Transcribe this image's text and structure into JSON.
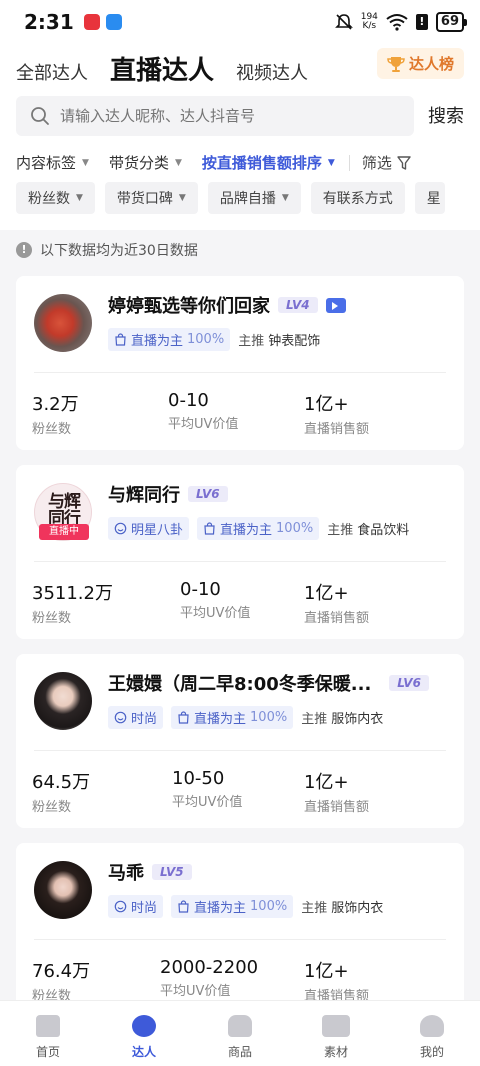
{
  "status_bar": {
    "time": "2:31",
    "net_speed_value": "194",
    "net_speed_unit": "K/s",
    "battery": "69"
  },
  "top_nav": {
    "tabs": [
      "全部达人",
      "直播达人",
      "视频达人"
    ],
    "active_tab": "直播达人",
    "rank_button": "达人榜"
  },
  "search": {
    "placeholder": "请输入达人昵称、达人抖音号",
    "button": "搜索"
  },
  "filters": {
    "items": [
      "内容标签",
      "带货分类",
      "按直播销售额排序"
    ],
    "active": "按直播销售额排序",
    "screen": "筛选"
  },
  "chips": [
    "粉丝数",
    "带货口碑",
    "品牌自播",
    "有联系方式",
    "星"
  ],
  "notice": "以下数据均为近30日数据",
  "creators": [
    {
      "name": "婷婷甄选等你们回家",
      "level": "LV4",
      "has_live_icon": true,
      "tags": [
        {
          "label": "直播为主",
          "pct": "100%"
        }
      ],
      "main_label": "主推",
      "main_category": "钟表配饰",
      "stats": [
        {
          "value": "3.2万",
          "label": "粉丝数"
        },
        {
          "value": "0-10",
          "label": "平均UV价值"
        },
        {
          "value": "1亿+",
          "label": "直播销售额"
        }
      ]
    },
    {
      "name": "与辉同行",
      "level": "LV6",
      "live_badge": "直播中",
      "avatar_text": "与辉同行",
      "tags": [
        {
          "label": "明星八卦"
        },
        {
          "label": "直播为主",
          "pct": "100%"
        }
      ],
      "main_label": "主推",
      "main_category": "食品饮料",
      "stats": [
        {
          "value": "3511.2万",
          "label": "粉丝数"
        },
        {
          "value": "0-10",
          "label": "平均UV价值"
        },
        {
          "value": "1亿+",
          "label": "直播销售额"
        }
      ]
    },
    {
      "name": "王嬛嬛（周二早8:00冬季保暖...",
      "level": "LV6",
      "tags": [
        {
          "label": "时尚"
        },
        {
          "label": "直播为主",
          "pct": "100%"
        }
      ],
      "main_label": "主推",
      "main_category": "服饰内衣",
      "stats": [
        {
          "value": "64.5万",
          "label": "粉丝数"
        },
        {
          "value": "10-50",
          "label": "平均UV价值"
        },
        {
          "value": "1亿+",
          "label": "直播销售额"
        }
      ]
    },
    {
      "name": "马乖",
      "level": "LV5",
      "tags": [
        {
          "label": "时尚"
        },
        {
          "label": "直播为主",
          "pct": "100%"
        }
      ],
      "main_label": "主推",
      "main_category": "服饰内衣",
      "stats": [
        {
          "value": "76.4万",
          "label": "粉丝数"
        },
        {
          "value": "2000-2200",
          "label": "平均UV价值"
        },
        {
          "value": "1亿+",
          "label": "直播销售额"
        }
      ]
    }
  ],
  "bottom_nav": {
    "items": [
      "首页",
      "达人",
      "商品",
      "素材",
      "我的"
    ],
    "active": "达人"
  },
  "colors": {
    "accent": "#3e5ad9",
    "rank_bg": "#fff3e4",
    "rank_text": "#e0782b",
    "live_red": "#f0345c",
    "level_text": "#7a6fd0"
  },
  "icons": [
    "bell-mute-icon",
    "wifi-icon",
    "search-icon",
    "trophy-icon",
    "filter-icon",
    "info-icon",
    "video-camera-icon",
    "shopping-bag-icon",
    "smile-tag-icon"
  ]
}
